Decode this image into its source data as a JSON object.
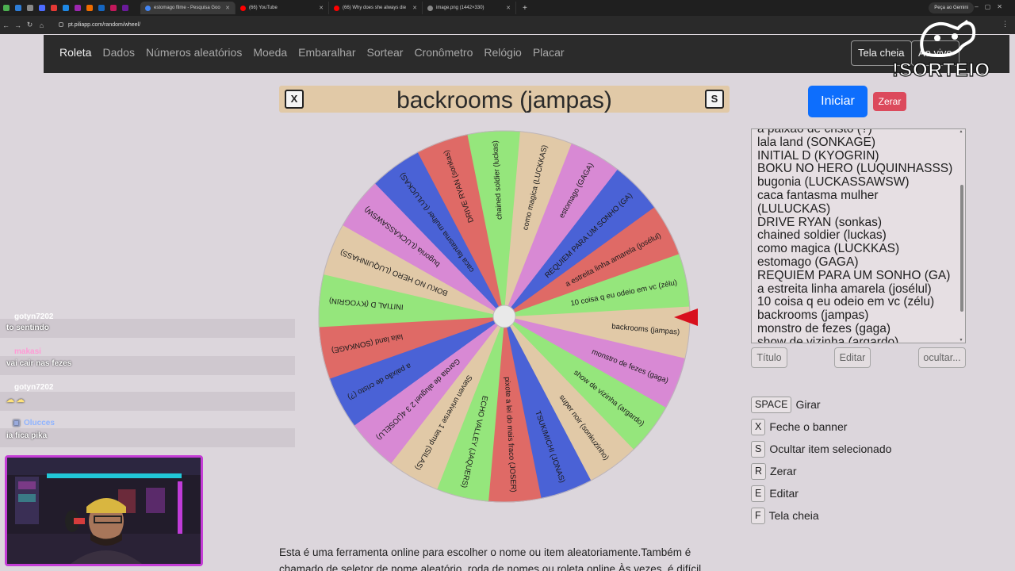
{
  "browser": {
    "tabs": [
      {
        "title": "estomago filme - Pesquisa Goo",
        "icon": "google-icon",
        "color": "#4285f4"
      },
      {
        "title": "(66) YouTube",
        "icon": "youtube-icon",
        "color": "#ff0000"
      },
      {
        "title": "(66) Why does she always die",
        "icon": "youtube-icon",
        "color": "#ff0000"
      },
      {
        "title": "image.png (1442×330)",
        "icon": "image-icon",
        "color": "#888888"
      }
    ],
    "new_tab": "+",
    "gemini": "Peça ao Gemini",
    "url": "pt.piliapp.com/random/wheel/"
  },
  "nav": {
    "links": [
      "Roleta",
      "Dados",
      "Números aleatórios",
      "Moeda",
      "Embaralhar",
      "Sortear",
      "Cronômetro",
      "Relógio",
      "Placar"
    ],
    "fullscreen": "Tela cheia",
    "live": "Ao vivo"
  },
  "banner": {
    "title": "backrooms (jampas)",
    "close_key": "X",
    "hide_key": "S"
  },
  "wheel": {
    "slices": [
      {
        "label": "backrooms (jampas)",
        "color": "#e1c9a7"
      },
      {
        "label": "monstro de fezes (gaga)",
        "color": "#d889d4"
      },
      {
        "label": "show de vizinha (argardo)",
        "color": "#95e67c"
      },
      {
        "label": "super noir (sonkuzinho)",
        "color": "#e1c9a7"
      },
      {
        "label": "TSUKIMICHI (JONAS)",
        "color": "#4a62d6"
      },
      {
        "label": "pixote a lei do mais fraco (JOSER)",
        "color": "#df6a66"
      },
      {
        "label": "ECHO VALLEY (JAQUERS)",
        "color": "#95e67c"
      },
      {
        "label": "Steven universe 1 temp (SILAS)",
        "color": "#e1c9a7"
      },
      {
        "label": "Garota de aluguel 2 3 4(JOSELU)",
        "color": "#d889d4"
      },
      {
        "label": "a paixão de cristo (?)",
        "color": "#4a62d6"
      },
      {
        "label": "lala land (SONKAGE)",
        "color": "#df6a66"
      },
      {
        "label": "INITIAL D (KYOGRIN)",
        "color": "#95e67c"
      },
      {
        "label": "BOKU NO HERO (LUQUINHASS)",
        "color": "#e1c9a7"
      },
      {
        "label": "bugonia (LUCKASSAWSW)",
        "color": "#d889d4"
      },
      {
        "label": "caca fantasma mulher (LULUCKAS)",
        "color": "#4a62d6"
      },
      {
        "label": "DRIVE RYAN (sonkas)",
        "color": "#df6a66"
      },
      {
        "label": "chained soldier (luckas)",
        "color": "#95e67c"
      },
      {
        "label": "como magica (LUCKKAS)",
        "color": "#e1c9a7"
      },
      {
        "label": "estomago (GAGA)",
        "color": "#d889d4"
      },
      {
        "label": "REQUIEM PARA UM SONHO (GA)",
        "color": "#4a62d6"
      },
      {
        "label": "a estreita linha amarela (josélul)",
        "color": "#df6a66"
      },
      {
        "label": "10 coisa q eu odeio em vc (zélu)",
        "color": "#95e67c"
      }
    ]
  },
  "controls": {
    "start": "Iniciar",
    "reset": "Zerar"
  },
  "entries": [
    "a paixão de cristo (?)",
    "lala land (SONKAGE)",
    "INITIAL D (KYOGRIN)",
    "BOKU NO HERO (LUQUINHASSS)",
    "bugonia (LUCKASSAWSW)",
    "caca fantasma mulher",
    "(LULUCKAS)",
    "DRIVE RYAN (sonkas)",
    "chained soldier (luckas)",
    "como magica (LUCKKAS)",
    "estomago (GAGA)",
    "REQUIEM PARA UM SONHO (GA)",
    "a estreita linha amarela (josélul)",
    "10 coisa q eu odeio em vc (zélu)",
    "backrooms (jampas)",
    "monstro de fezes (gaga)",
    "show de vizinha (argardo)"
  ],
  "entry_buttons": {
    "title": "Título",
    "edit": "Editar",
    "hide": "ocultar..."
  },
  "shortcuts": [
    {
      "key": "SPACE",
      "label": "Girar"
    },
    {
      "key": "X",
      "label": "Feche o banner"
    },
    {
      "key": "S",
      "label": "Ocultar item selecionado"
    },
    {
      "key": "R",
      "label": "Zerar"
    },
    {
      "key": "E",
      "label": "Editar"
    },
    {
      "key": "F",
      "label": "Tela cheia"
    }
  ],
  "description": "Esta é uma ferramenta online para escolher o nome ou item aleatoriamente.Também é chamado de seletor de nome aleatório, roda de nomes ou roleta online.Às vezes, é difícil",
  "chat": [
    {
      "user": "gotyn7202",
      "user_color": "#ffffff",
      "message": "to sentindo"
    },
    {
      "user": "makasi",
      "user_color": "#ff9ad6",
      "message": "vai cair nas fezes"
    },
    {
      "user": "gotyn7202",
      "user_color": "#ffffff",
      "message": ""
    },
    {
      "user": "Olucces",
      "user_color": "#8fb4ff",
      "message": "ia fica pika"
    }
  ],
  "logo_text": "!SORTEIO"
}
